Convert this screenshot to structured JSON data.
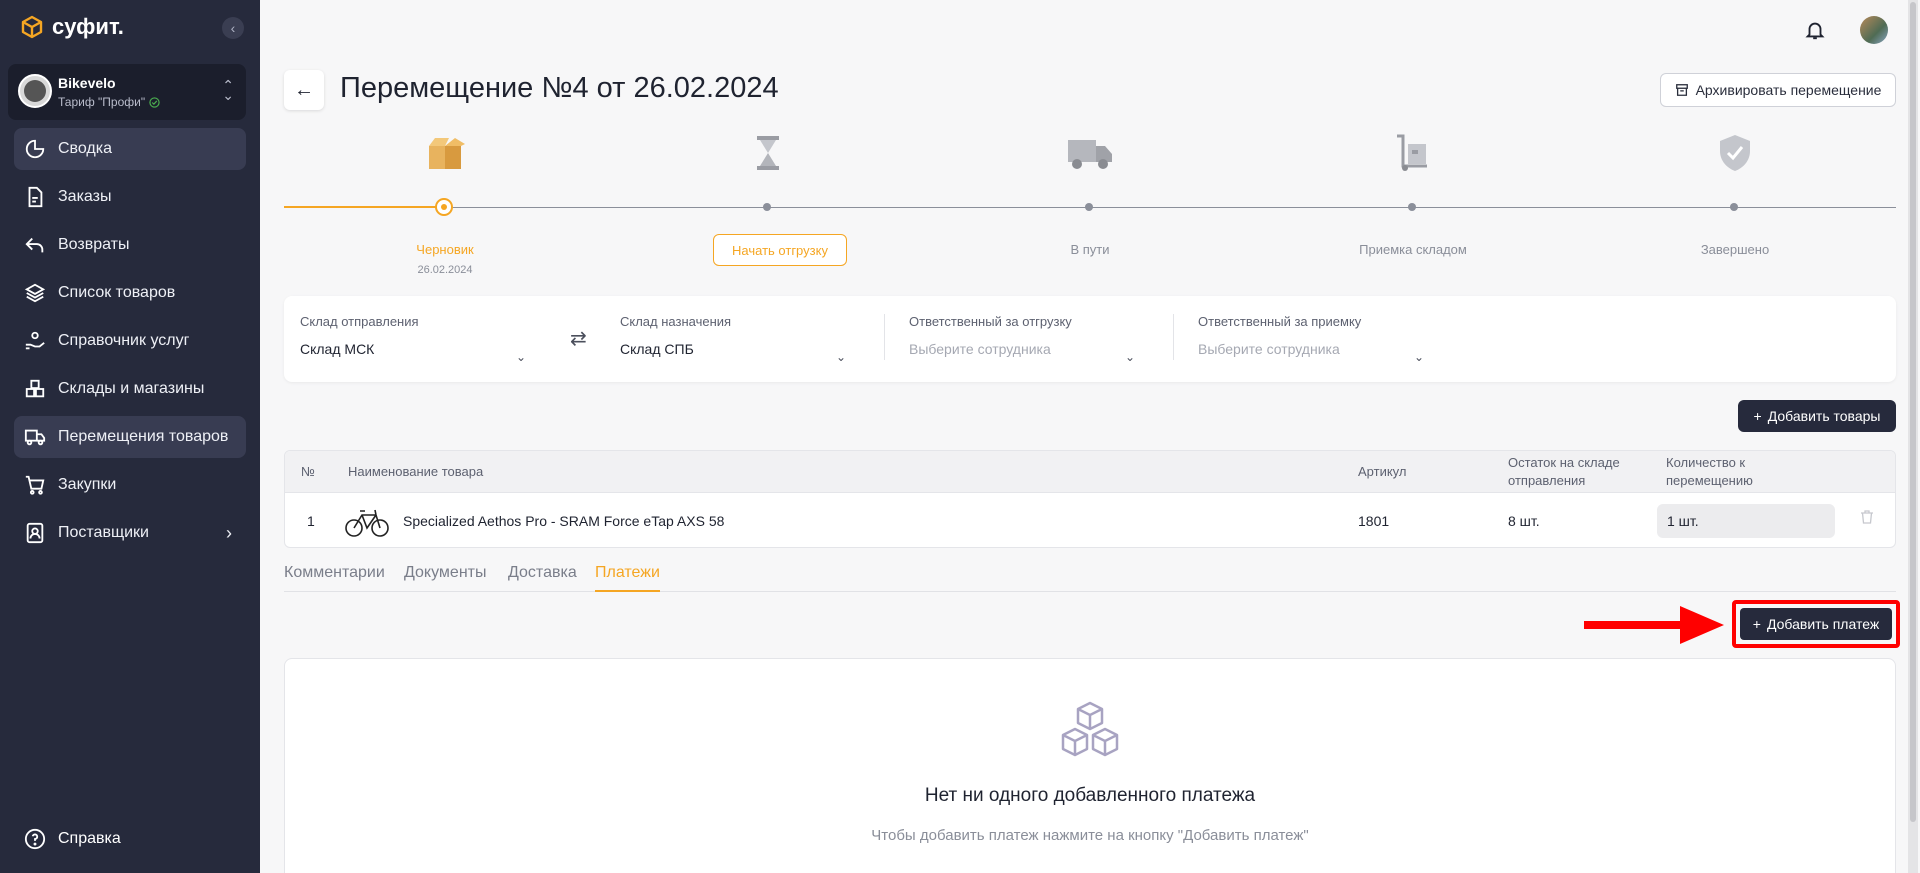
{
  "app": {
    "logo_text": "суфит."
  },
  "org": {
    "name": "Bikevelo",
    "plan": "Тариф \"Профи\""
  },
  "nav": {
    "items": [
      {
        "label": "Сводка",
        "icon": "pie-chart-icon",
        "active": true
      },
      {
        "label": "Заказы",
        "icon": "document-icon"
      },
      {
        "label": "Возвраты",
        "icon": "return-arrow-icon"
      },
      {
        "label": "Список товаров",
        "icon": "layers-icon"
      },
      {
        "label": "Справочник услуг",
        "icon": "service-hand-icon"
      },
      {
        "label": "Склады и магазины",
        "icon": "warehouse-icon"
      },
      {
        "label": "Перемещения товаров",
        "icon": "truck-icon",
        "active": true
      },
      {
        "label": "Закупки",
        "icon": "cart-icon"
      },
      {
        "label": "Поставщики",
        "icon": "contacts-icon",
        "has_arrow": true
      }
    ],
    "help_label": "Справка"
  },
  "header": {
    "title": "Перемещение №4 от 26.02.2024",
    "archive_label": "Архивировать перемещение"
  },
  "stepper": {
    "steps": [
      {
        "label": "Черновик",
        "date": "26.02.2024",
        "icon": "box-icon",
        "state": "current"
      },
      {
        "label": "Начать отгрузку",
        "icon": "hourglass-icon",
        "state": "action"
      },
      {
        "label": "В пути",
        "icon": "truck-icon",
        "state": "pending"
      },
      {
        "label": "Приемка складом",
        "icon": "hand-truck-icon",
        "state": "pending"
      },
      {
        "label": "Завершено",
        "icon": "shield-check-icon",
        "state": "pending"
      }
    ]
  },
  "warehouses": {
    "from": {
      "label": "Склад отправления",
      "value": "Склад МСК"
    },
    "to": {
      "label": "Склад назначения",
      "value": "Склад СПБ"
    },
    "ship_resp": {
      "label": "Ответственный за отгрузку",
      "placeholder": "Выберите сотрудника"
    },
    "recv_resp": {
      "label": "Ответственный за приемку",
      "placeholder": "Выберите сотрудника"
    }
  },
  "add_goods_label": "Добавить товары",
  "table": {
    "headers": {
      "num": "№",
      "name": "Наименование товара",
      "article": "Артикул",
      "stock_l1": "Остаток на складе",
      "stock_l2": "отправления",
      "qty_l1": "Количество к",
      "qty_l2": "перемещению"
    },
    "rows": [
      {
        "num": "1",
        "name": "Specialized Aethos Pro - SRAM Force eTap AXS 58",
        "article": "1801",
        "stock": "8 шт.",
        "qty": "1 шт."
      }
    ]
  },
  "tabs": [
    {
      "label": "Комментарии"
    },
    {
      "label": "Документы"
    },
    {
      "label": "Доставка"
    },
    {
      "label": "Платежи",
      "active": true
    }
  ],
  "add_payment_label": "Добавить платеж",
  "empty": {
    "title": "Нет ни одного добавленного платежа",
    "subtitle": "Чтобы добавить платеж нажмите на кнопку \"Добавить платеж\""
  },
  "colors": {
    "accent": "#f5a623",
    "sidebar": "#262a3c",
    "highlight": "#ff0000"
  }
}
